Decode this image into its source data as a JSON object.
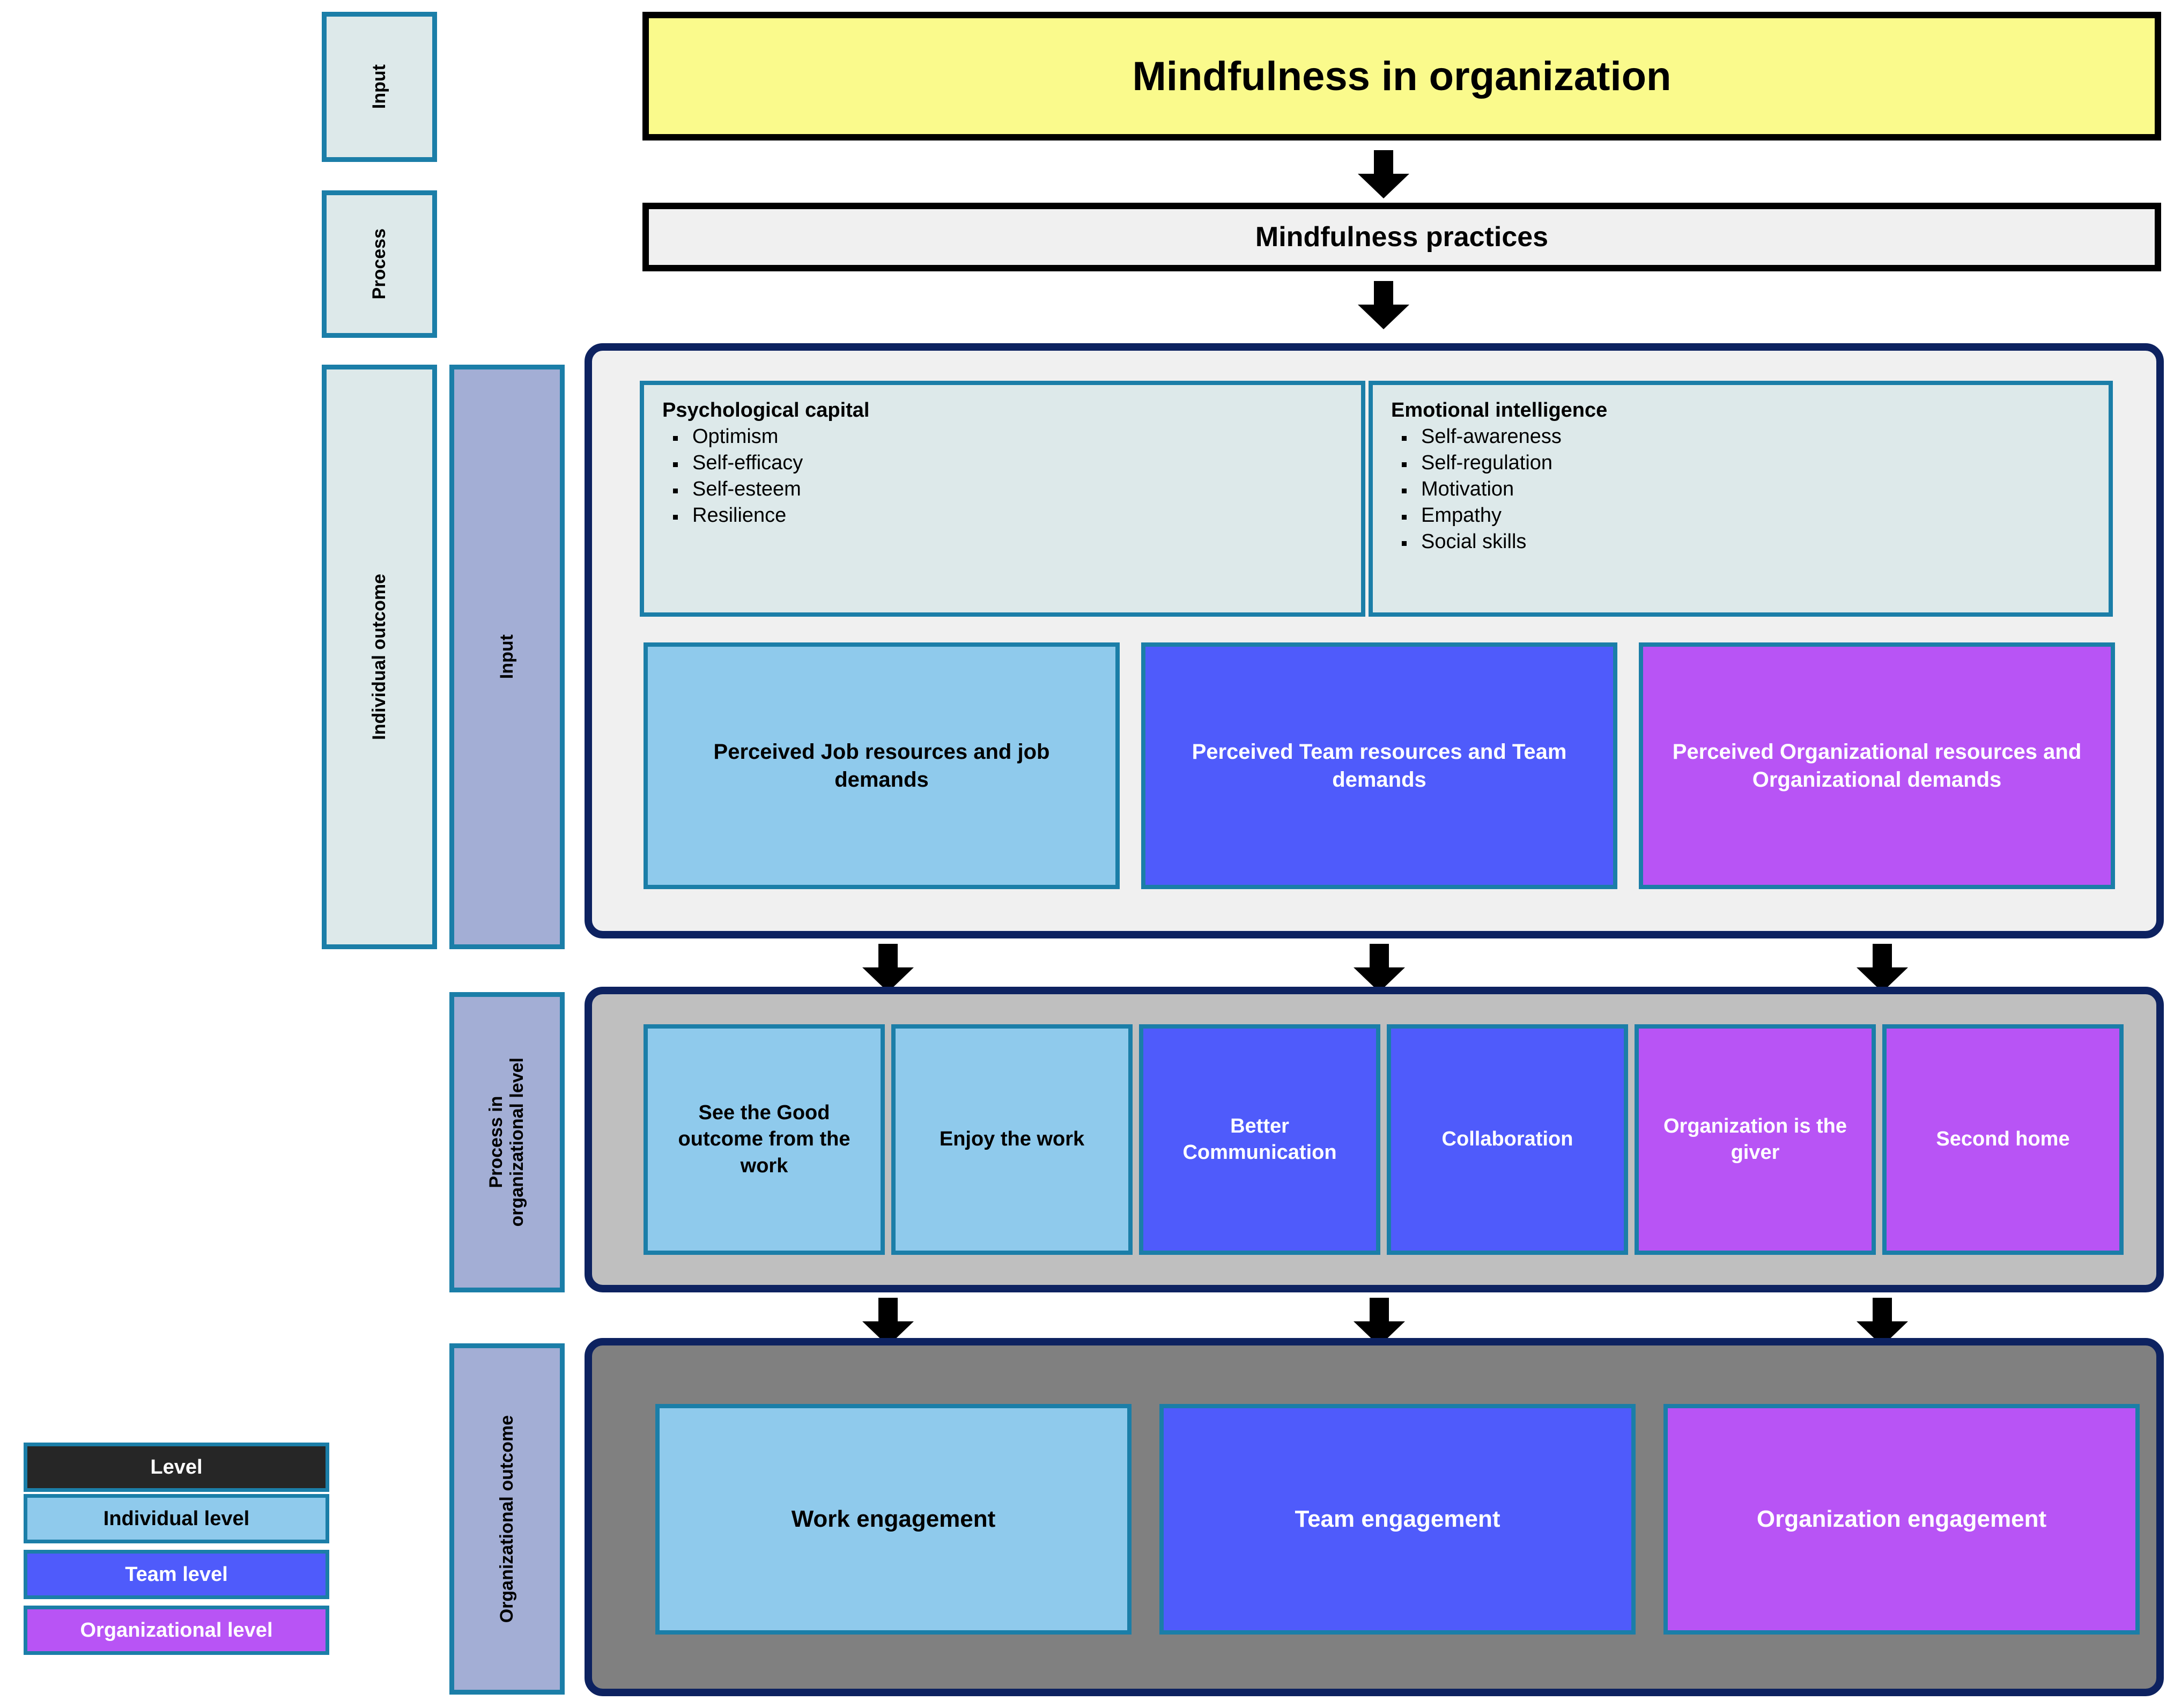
{
  "title_banner": {
    "label": "Mindfulness in organization"
  },
  "process_banner": {
    "label": "Mindfulness practices"
  },
  "stage_labels": {
    "input_top": "Input",
    "process_top": "Process",
    "individual_outcome": "Individual outcome",
    "input_inner": "Input",
    "process_org_level": "Process in\norganizational level",
    "organizational_outcome": "Organizational outcome"
  },
  "individual_outcome": {
    "psychological_capital": {
      "heading": "Psychological capital",
      "items": [
        "Optimism",
        "Self-efficacy",
        "Self-esteem",
        "Resilience"
      ]
    },
    "emotional_intelligence": {
      "heading": "Emotional intelligence",
      "items": [
        "Self-awareness",
        "Self-regulation",
        "Motivation",
        "Empathy",
        "Social skills"
      ]
    },
    "perceived": [
      {
        "label": "Perceived Job resources and job demands",
        "level": "individual"
      },
      {
        "label": "Perceived Team resources and Team demands",
        "level": "team"
      },
      {
        "label": "Perceived Organizational resources and Organizational demands",
        "level": "organizational"
      }
    ]
  },
  "process_row": {
    "items": [
      {
        "label": "See the Good outcome from the work",
        "level": "individual"
      },
      {
        "label": "Enjoy the work",
        "level": "individual"
      },
      {
        "label": "Better Communication",
        "level": "team"
      },
      {
        "label": "Collaboration",
        "level": "team"
      },
      {
        "label": "Organization is the giver",
        "level": "organizational"
      },
      {
        "label": "Second home",
        "level": "organizational"
      }
    ]
  },
  "outcome_row": {
    "items": [
      {
        "label": "Work engagement",
        "level": "individual"
      },
      {
        "label": "Team engagement",
        "level": "team"
      },
      {
        "label": "Organization engagement",
        "level": "organizational"
      }
    ]
  },
  "legend": {
    "header": "Level",
    "items": [
      {
        "label": "Individual level",
        "color": "#8FCAEC"
      },
      {
        "label": "Team level",
        "color": "#4F5BFB"
      },
      {
        "label": "Organizational level",
        "color": "#B854F5"
      }
    ]
  },
  "colors": {
    "individual": "#8FCAEC",
    "team": "#4F5BFB",
    "organizational": "#B854F5",
    "teal_border": "#1B7EA8",
    "navy_border": "#0D2260",
    "title_yellow": "#FAFA8C",
    "pale": "#DDE9EA",
    "lavender": "#A3AED5"
  }
}
